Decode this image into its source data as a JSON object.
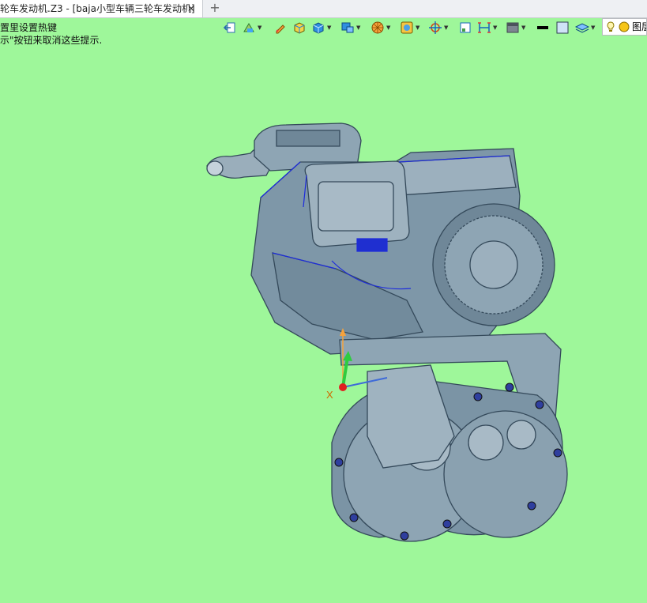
{
  "window": {
    "tab_title": "轮车发动机.Z3 - [baja小型车辆三轮车发动机]",
    "close_glyph": "✕",
    "new_tab_glyph": "+"
  },
  "hints": {
    "line1": "置里设置热键",
    "line2": "示\"按钮来取消这些提示."
  },
  "toolbar": {
    "layer_label": "图层",
    "icons": [
      "exit-sketch-icon",
      "view-orient-icon",
      "pencil-icon",
      "box-shade-icon",
      "cube-display-icon",
      "display-mode-icon",
      "render-style-icon",
      "filter-icon",
      "snap-target-icon",
      "frame-select-icon",
      "align-icon",
      "background-icon",
      "line-color-icon",
      "fill-color-icon",
      "layers-icon",
      "light-bulb-icon",
      "layer-status-icon"
    ]
  },
  "triad": {
    "x_label": "X"
  },
  "colors": {
    "background": "#9ef79a",
    "model": "#7e97a8",
    "model_dark": "#38495a",
    "edge_highlight": "#1d2bdc"
  }
}
